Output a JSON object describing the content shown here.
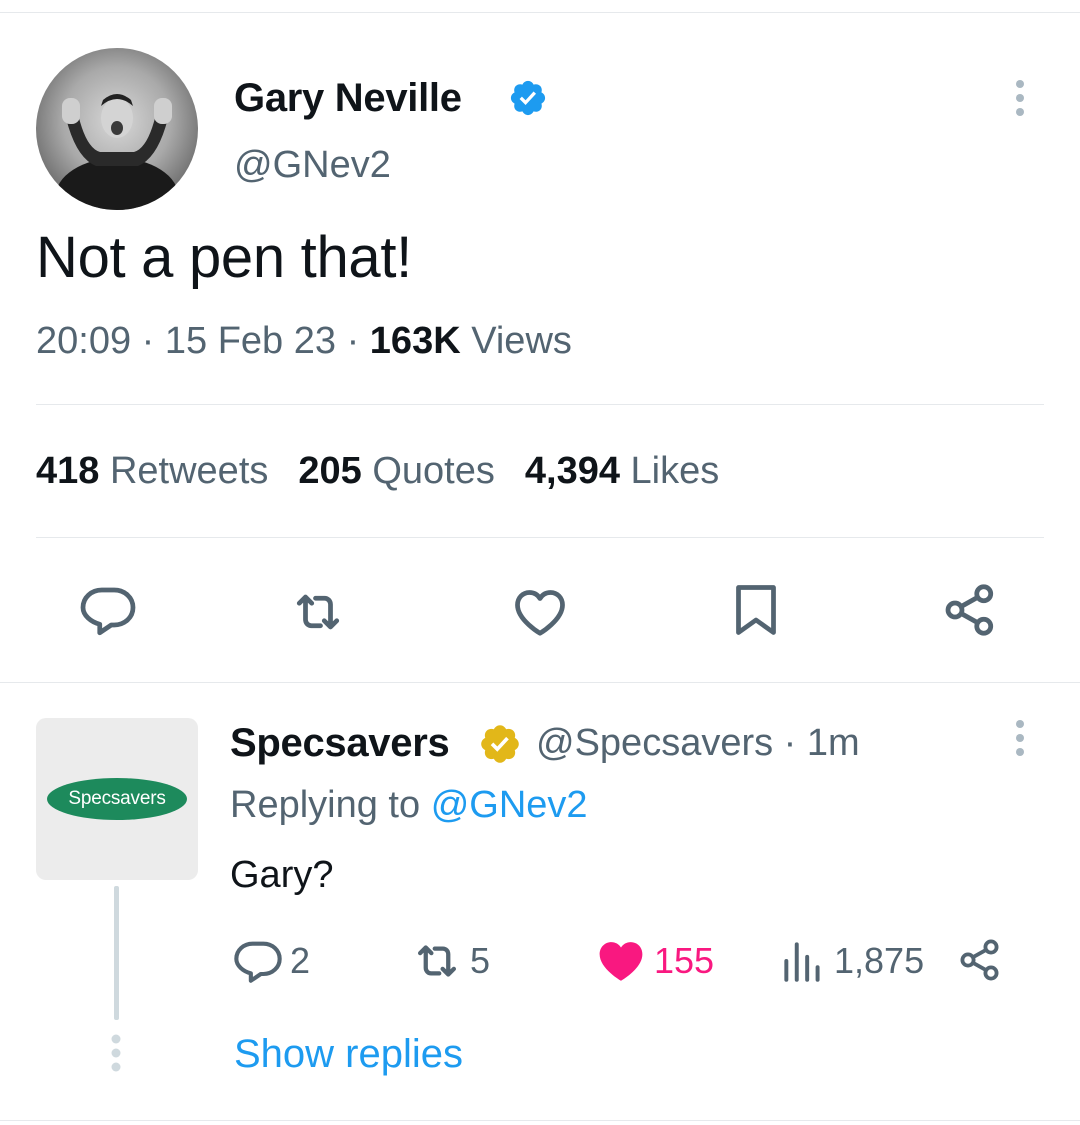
{
  "tweet": {
    "author_name": "Gary Neville",
    "author_handle": "@GNev2",
    "text": "Not a pen that!",
    "time": "20:09",
    "date": "15 Feb 23",
    "views_count": "163K",
    "views_label": "Views",
    "retweets_count": "418",
    "retweets_label": "Retweets",
    "quotes_count": "205",
    "quotes_label": "Quotes",
    "likes_count": "4,394",
    "likes_label": "Likes",
    "actions": [
      "reply-icon",
      "retweet-icon",
      "like-icon",
      "bookmark-icon",
      "share-icon"
    ]
  },
  "reply": {
    "author_name": "Specsavers",
    "author_handle": "@Specsavers",
    "time": "1m",
    "replying_to_label": "Replying to",
    "replying_to_handle": "@GNev2",
    "text": "Gary?",
    "logo_text": "Specsavers",
    "reply_count": "2",
    "retweet_count": "5",
    "like_count": "155",
    "view_count": "1,875",
    "show_replies": "Show replies"
  },
  "colors": {
    "text_primary": "#0f1419",
    "text_secondary": "#536471",
    "link": "#1d9bf0",
    "like": "#f91880",
    "verified_blue": "#1d9bf0",
    "verified_gold": "#e2b719",
    "brand_green": "#1d8a5c"
  }
}
